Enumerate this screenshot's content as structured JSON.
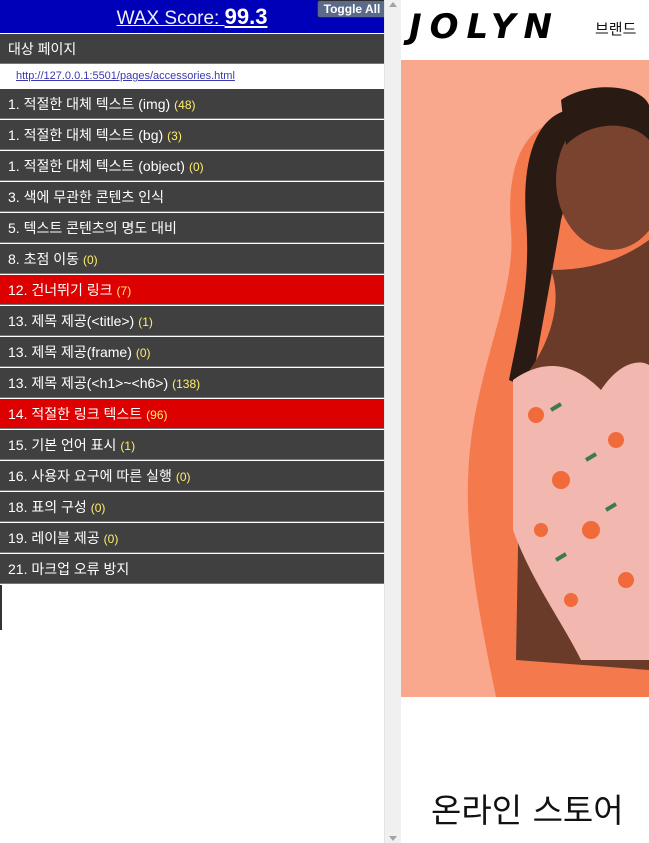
{
  "wax": {
    "score_label": "WAX Score: ",
    "score_value": "99.3",
    "toggle_all": "Toggle All",
    "target_page_label": "대상 페이지",
    "url": "http://127.0.0.1:5501/pages/accessories.html",
    "items": [
      {
        "label": "1. 적절한 대체 텍스트 (img)",
        "count": "(48)",
        "status": "normal"
      },
      {
        "label": "1. 적절한 대체 텍스트 (bg)",
        "count": "(3)",
        "status": "normal"
      },
      {
        "label": "1. 적절한 대체 텍스트 (object)",
        "count": "(0)",
        "status": "normal"
      },
      {
        "label": "3. 색에 무관한 콘텐츠 인식",
        "count": "",
        "status": "normal"
      },
      {
        "label": "5. 텍스트 콘텐츠의 명도 대비",
        "count": "",
        "status": "normal"
      },
      {
        "label": "8. 초점 이동",
        "count": "(0)",
        "status": "normal"
      },
      {
        "label": "12. 건너뛰기 링크",
        "count": "(7)",
        "status": "error"
      },
      {
        "label": "13. 제목 제공(<title>)",
        "count": "(1)",
        "status": "normal"
      },
      {
        "label": "13. 제목 제공(frame)",
        "count": "(0)",
        "status": "normal"
      },
      {
        "label": "13. 제목 제공(<h1>~<h6>)",
        "count": "(138)",
        "status": "normal"
      },
      {
        "label": "14. 적절한 링크 텍스트",
        "count": "(96)",
        "status": "error"
      },
      {
        "label": "15. 기본 언어 표시",
        "count": "(1)",
        "status": "normal"
      },
      {
        "label": "16. 사용자 요구에 따른 실행",
        "count": "(0)",
        "status": "normal"
      },
      {
        "label": "18. 표의 구성",
        "count": "(0)",
        "status": "normal"
      },
      {
        "label": "19. 레이블 제공",
        "count": "(0)",
        "status": "normal"
      },
      {
        "label": "21. 마크업 오류 방지",
        "count": "",
        "status": "normal"
      }
    ]
  },
  "site": {
    "logo": "JOLYN",
    "nav_brand": "브랜드",
    "section_title": "온라인 스토어"
  },
  "colors": {
    "header_blue": "#0000b8",
    "row_gray": "#404040",
    "row_error": "#dd0000",
    "count_yellow": "#ffef6b",
    "hero_bg": "#f9a88e"
  }
}
